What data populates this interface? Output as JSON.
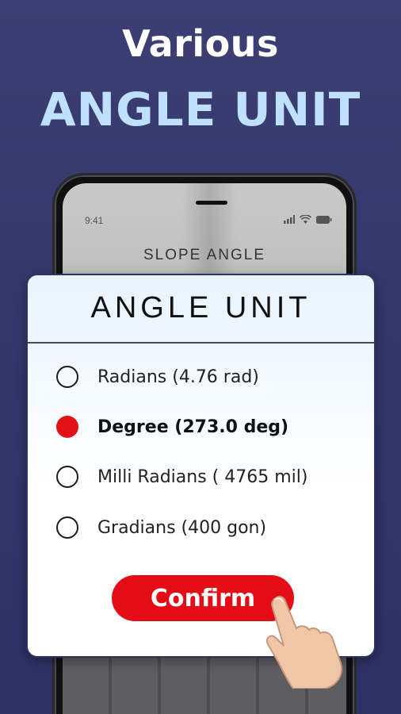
{
  "headline": {
    "line1": "Various",
    "line2": "ANGLE UNIT"
  },
  "phone": {
    "status_time": "9:41",
    "screen_title": "SLOPE ANGLE"
  },
  "dialog": {
    "title": "ANGLE UNIT",
    "options": [
      {
        "label": "Radians (4.76 rad)",
        "selected": false
      },
      {
        "label": "Degree (273.0 deg)",
        "selected": true
      },
      {
        "label": "Milli Radians ( 4765 mil)",
        "selected": false
      },
      {
        "label": "Gradians (400 gon)",
        "selected": false
      }
    ],
    "confirm_label": "Confirm"
  },
  "colors": {
    "background": "#34376a",
    "accent_text": "#bfe1ff",
    "primary": "#e40d15"
  },
  "icons": [
    "signal-icon",
    "wifi-icon",
    "battery-icon",
    "pointing-hand-icon"
  ]
}
